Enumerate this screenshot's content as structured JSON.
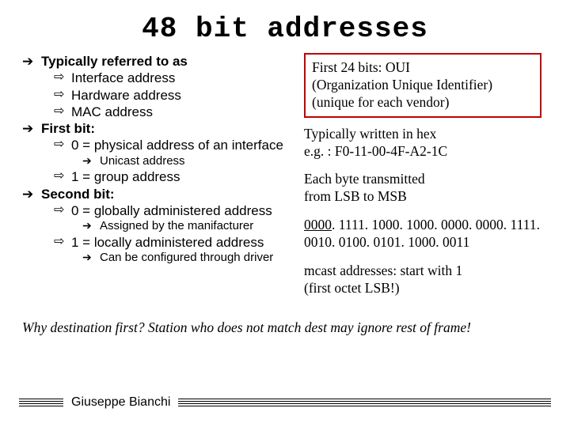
{
  "title": "48 bit addresses",
  "left": {
    "b1": {
      "head": "Typically referred to as",
      "items": [
        "Interface address",
        "Hardware address",
        "MAC address"
      ]
    },
    "b2": {
      "head": "First bit:",
      "items": [
        "0 = physical address of an interface"
      ],
      "sub1": "Unicast address",
      "items2": [
        "1 = group address"
      ]
    },
    "b3": {
      "head": "Second bit:",
      "items": [
        "0 = globally administered address"
      ],
      "sub1": "Assigned by the manifacturer",
      "items2": [
        "1 = locally administered address"
      ],
      "sub2": "Can be configured through driver"
    }
  },
  "right": {
    "box": {
      "l1": "First 24 bits: OUI",
      "l2": "(Organization Unique Identifier)",
      "l3": "(unique for each vendor)"
    },
    "p1": {
      "l1": "Typically written in hex",
      "l2": "e.g. : F0-11-00-4F-A2-1C"
    },
    "p2": {
      "l1": "Each byte transmitted",
      "l2": "from LSB to MSB"
    },
    "p3": {
      "pre": "0000",
      "rest": ". 1111. 1000. 1000. 0000. 0000. 1111. 0010. 0100. 0101. 1000. 0011"
    },
    "p4": {
      "l1": "mcast addresses: start with 1",
      "l2": "(first octet LSB!)"
    }
  },
  "footerq": "Why destination first? Station who does not match dest may ignore rest of frame!",
  "author": "Giuseppe Bianchi"
}
